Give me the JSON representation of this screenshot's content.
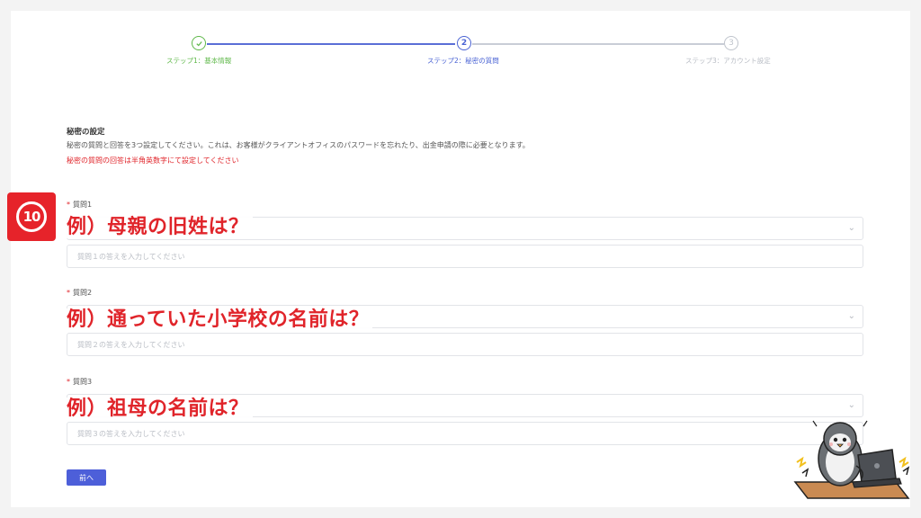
{
  "stepper": {
    "steps": [
      {
        "label": "ステップ1：基本情報",
        "status": "done",
        "icon": "check-icon"
      },
      {
        "label": "ステップ2：秘密の質問",
        "status": "active",
        "number": "2"
      },
      {
        "label": "ステップ3：アカウント設定",
        "status": "pending",
        "number": "3"
      }
    ],
    "colors": {
      "done": "#5fb84a",
      "active": "#4a63d4",
      "pending": "#bfc4cc"
    }
  },
  "section": {
    "title": "秘密の設定",
    "description": "秘密の質問と回答を3つ設定してください。これは、お客様がクライアントオフィスのパスワードを忘れたり、出金申請の際に必要となります。",
    "warning": "秘密の質問の回答は半角英数字にて設定してください"
  },
  "badge": {
    "text": "⑩",
    "color": "#e6232a"
  },
  "questions": [
    {
      "label": "質問1",
      "required": "*",
      "overlay": "例）母親の旧姓は？",
      "placeholder": "質問１の答えを入力してください"
    },
    {
      "label": "質問2",
      "required": "*",
      "overlay": "例）通っていた小学校の名前は？",
      "placeholder": "質問２の答えを入力してください"
    },
    {
      "label": "質問3",
      "required": "*",
      "overlay": "例）祖母の名前は？",
      "placeholder": "質問３の答えを入力してください"
    }
  ],
  "buttons": {
    "prev_label": "前へ",
    "prev_color": "#4d5fd9"
  },
  "mascot": {
    "icon": "penguin-laptop-icon"
  }
}
